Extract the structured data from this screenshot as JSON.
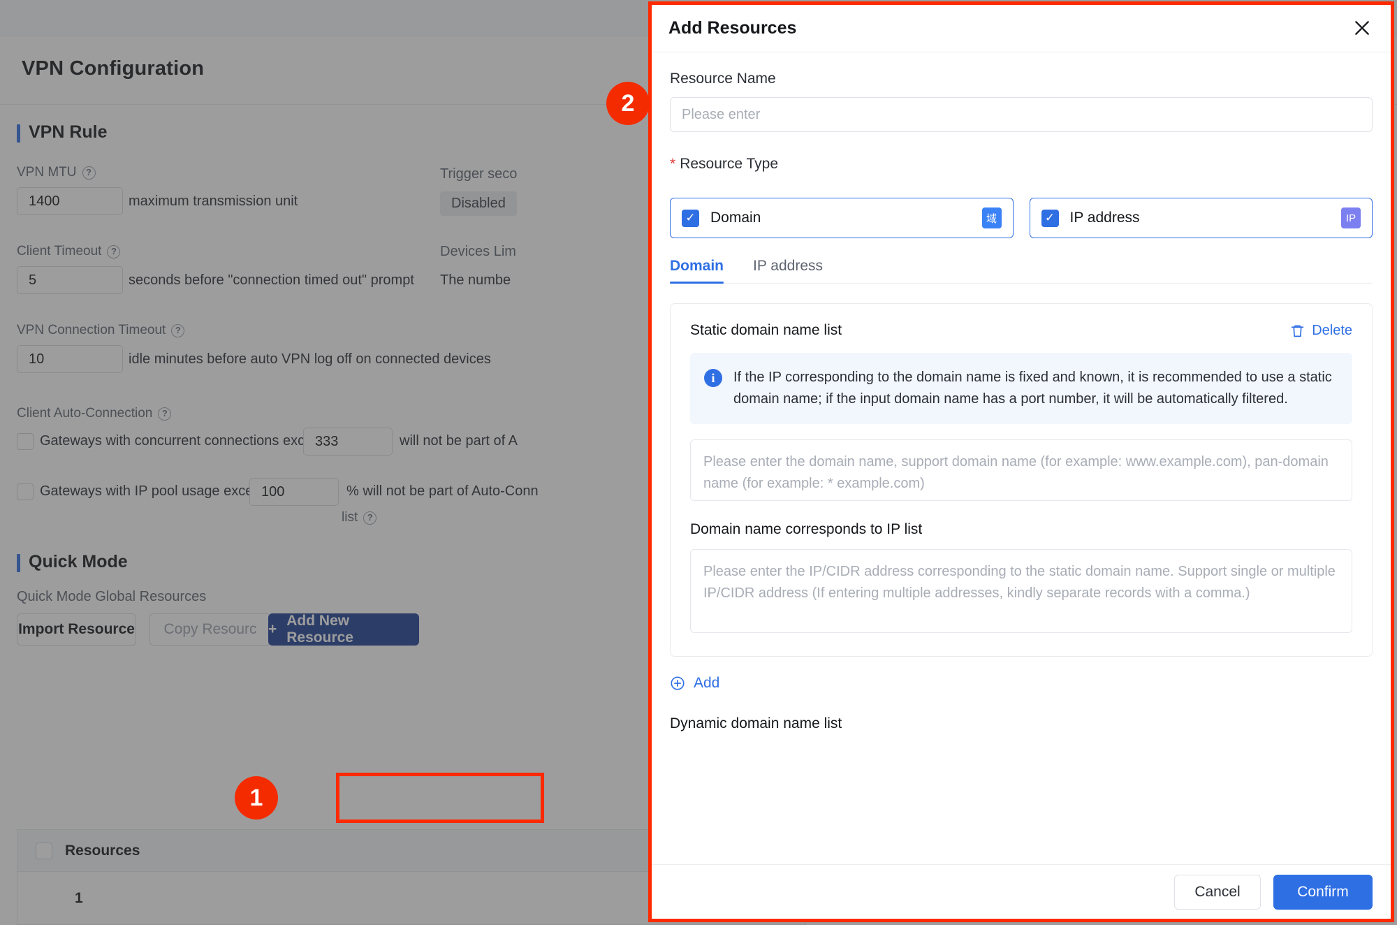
{
  "background": {
    "page_title": "VPN Configuration",
    "sections": {
      "vpn_rule": "VPN Rule",
      "quick_mode": "Quick Mode"
    },
    "fields": {
      "vpn_mtu_label": "VPN MTU",
      "vpn_mtu_value": "1400",
      "vpn_mtu_hint": "maximum transmission unit",
      "client_timeout_label": "Client Timeout",
      "client_timeout_value": "5",
      "client_timeout_hint": "seconds before \"connection timed out\" prompt",
      "vpn_conn_timeout_label": "VPN Connection Timeout",
      "vpn_conn_timeout_value": "10",
      "vpn_conn_timeout_hint": "idle minutes before auto VPN log off on connected devices",
      "trigger_label": "Trigger seco",
      "trigger_status": "Disabled",
      "devices_limit_label": "Devices Lim",
      "devices_limit_hint": "The numbe",
      "client_auto_conn_label": "Client Auto-Connection",
      "auto_conn_rule1_label": "Gateways with concurrent connections exceeding",
      "auto_conn_rule1_value": "333",
      "auto_conn_rule1_suffix": "will not be part of A",
      "auto_conn_rule2_label": "Gateways with IP pool usage exceeding",
      "auto_conn_rule2_value": "100",
      "auto_conn_rule2_suffix": "% will not be part of Auto-Conn",
      "auto_conn_rule2_suffix2": "list"
    },
    "quick_mode": {
      "global_resources_label": "Quick Mode Global Resources",
      "import_resource": "Import Resource",
      "copy_resource": "Copy Resourc",
      "add_new_resource": "Add New Resource",
      "add_icon": "plus-icon",
      "table_header": "Resources",
      "row_1": "1"
    }
  },
  "modal": {
    "title": "Add Resources",
    "close_icon": "close-icon",
    "resource_name": {
      "label": "Resource Name",
      "placeholder": "Please enter",
      "value": ""
    },
    "resource_type": {
      "label": "Resource Type",
      "required_mark": "*",
      "options": [
        {
          "label": "Domain",
          "checked": true,
          "badge": "域",
          "badge_color": "#3b82f6"
        },
        {
          "label": "IP address",
          "checked": true,
          "badge": "IP",
          "badge_color": "#7b7ff0"
        }
      ]
    },
    "tabs": [
      {
        "label": "Domain",
        "active": true
      },
      {
        "label": "IP address",
        "active": false
      }
    ],
    "domain_panel": {
      "static_list_title": "Static domain name list",
      "delete_label": "Delete",
      "delete_icon": "trash-icon",
      "info_icon": "info-icon",
      "info_text": "If the IP corresponding to the domain name is fixed and known, it is recommended to use a static domain name; if the input domain name has a port number, it will be automatically filtered.",
      "domain_placeholder": "Please enter the domain name, support domain name (for example: www.example.com), pan-domain name (for example: * example.com)",
      "domain_value": "",
      "ip_list_label": "Domain name corresponds to IP list",
      "ip_placeholder": "Please enter the IP/CIDR address corresponding to the static domain name. Support single or multiple IP/CIDR address (If entering multiple addresses, kindly separate records with a comma.)",
      "ip_value": "",
      "add_label": "Add",
      "add_icon": "plus-circle-icon",
      "dynamic_list_title": "Dynamic domain name list"
    },
    "footer": {
      "cancel": "Cancel",
      "confirm": "Confirm"
    }
  },
  "annotations": {
    "marker_1": "1",
    "marker_2": "2",
    "highlight_color": "#ff2a00"
  },
  "colors": {
    "primary_blue": "#2f6fe4",
    "dark_blue_button": "#1c3f94",
    "marker_red": "#f52b00",
    "required_red": "#e34040"
  }
}
